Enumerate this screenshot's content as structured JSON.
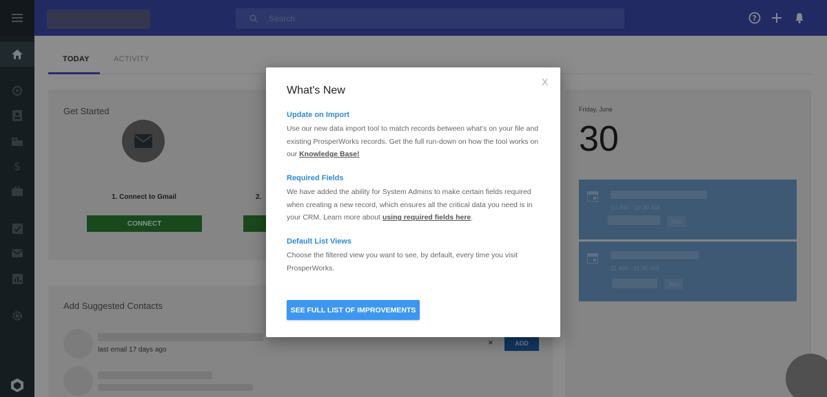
{
  "search": {
    "placeholder": "Search"
  },
  "tabs": [
    {
      "label": "TODAY"
    },
    {
      "label": "ACTIVITY"
    }
  ],
  "get_started": {
    "title": "Get Started",
    "step1_label": "1. Connect to Gmail",
    "step1_button": "CONNECT",
    "step2_label": "2."
  },
  "suggested": {
    "title": "Add Suggested Contacts",
    "contact1_meta": "last email 17 days ago",
    "add_label": "ADD",
    "dismiss": "×"
  },
  "calendar": {
    "date_label": "Friday, June",
    "date_number": "30",
    "events": [
      {
        "time": "10 AM - 10:30 AM",
        "who": "You"
      },
      {
        "time": "11 AM - 11:30 AM",
        "who": "You"
      }
    ]
  },
  "modal": {
    "title": "What's New",
    "close": "X",
    "sections": [
      {
        "heading": "Update on Import",
        "body": "Use our new data import tool to match records between what's on your file and existing ProsperWorks records. Get the full run-down on how the tool works on our ",
        "link": "Knowledge Base!",
        "tail": ""
      },
      {
        "heading": "Required Fields",
        "body": "We have added the ability for System Admins to make certain fields required when creating a new record, which ensures all the critical data you need is in your CRM. Learn more about ",
        "link": "using required fields here",
        "tail": "."
      },
      {
        "heading": "Default List Views",
        "body": "Choose the filtered view you want to see, by default, every time you visit ProsperWorks.",
        "link": "",
        "tail": ""
      }
    ],
    "cta": "SEE FULL LIST OF IMPROVEMENTS"
  },
  "colors": {
    "header": "#3949ab",
    "sidebar": "#263238",
    "link_blue": "#2d8ad8",
    "cta_blue": "#3d97f0"
  },
  "icons": [
    "menu-icon",
    "home-icon",
    "target-icon",
    "contacts-icon",
    "building-icon",
    "dollar-icon",
    "briefcase-icon",
    "task-icon",
    "mail-icon",
    "report-icon",
    "gear-icon",
    "app-logo-icon",
    "search-icon",
    "help-icon",
    "plus-icon",
    "bell-icon",
    "envelope-icon",
    "calendar-icon"
  ]
}
